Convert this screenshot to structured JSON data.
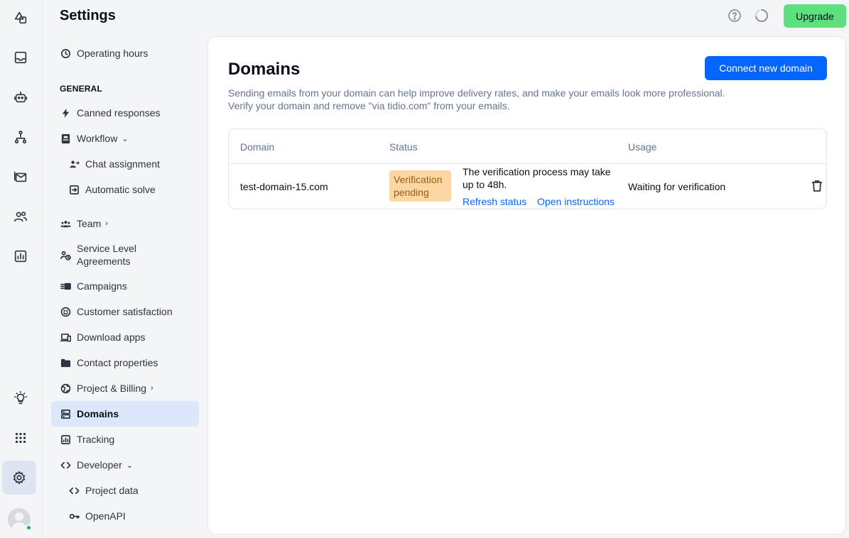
{
  "header": {
    "title": "Settings",
    "upgrade_label": "Upgrade"
  },
  "rail": {
    "items": [
      {
        "icon": "shapes-icon"
      },
      {
        "icon": "inbox-icon"
      },
      {
        "icon": "bot-icon"
      },
      {
        "icon": "flows-icon"
      },
      {
        "icon": "mail-icon"
      },
      {
        "icon": "contacts-icon"
      },
      {
        "icon": "analytics-icon"
      },
      {
        "icon": "lightbulb-icon"
      },
      {
        "icon": "apps-grid-icon"
      },
      {
        "icon": "settings-gear-icon"
      }
    ]
  },
  "sidebar": {
    "operating_hours": "Operating hours",
    "section_general": "GENERAL",
    "canned_responses": "Canned responses",
    "workflow": "Workflow",
    "chat_assignment": "Chat assignment",
    "automatic_solve": "Automatic solve",
    "team": "Team",
    "sla_line1": "Service Level",
    "sla_line2": "Agreements",
    "campaigns": "Campaigns",
    "customer_satisfaction": "Customer satisfaction",
    "download_apps": "Download apps",
    "contact_properties": "Contact properties",
    "project_billing": "Project & Billing",
    "domains": "Domains",
    "tracking": "Tracking",
    "developer": "Developer",
    "project_data": "Project data",
    "openapi": "OpenAPI"
  },
  "main": {
    "title": "Domains",
    "connect_label": "Connect new domain",
    "description_line1": "Sending emails from your domain can help improve delivery rates, and make your emails look more professional.",
    "description_line2": "Verify your domain and remove \"via tidio.com\" from your emails.",
    "table": {
      "columns": [
        "Domain",
        "Status",
        "Usage"
      ],
      "rows": [
        {
          "domain": "test-domain-15.com",
          "status_line1": "Verification",
          "status_line2": "pending",
          "status_color": "#fdd7a3",
          "message": "The verification process may take up to 48h.",
          "refresh_label": "Refresh status",
          "instructions_label": "Open instructions",
          "usage": "Waiting for verification"
        }
      ]
    }
  },
  "colors": {
    "primary": "#0566ff",
    "upgrade": "#5ee07e",
    "active_nav": "#dde7fb"
  }
}
